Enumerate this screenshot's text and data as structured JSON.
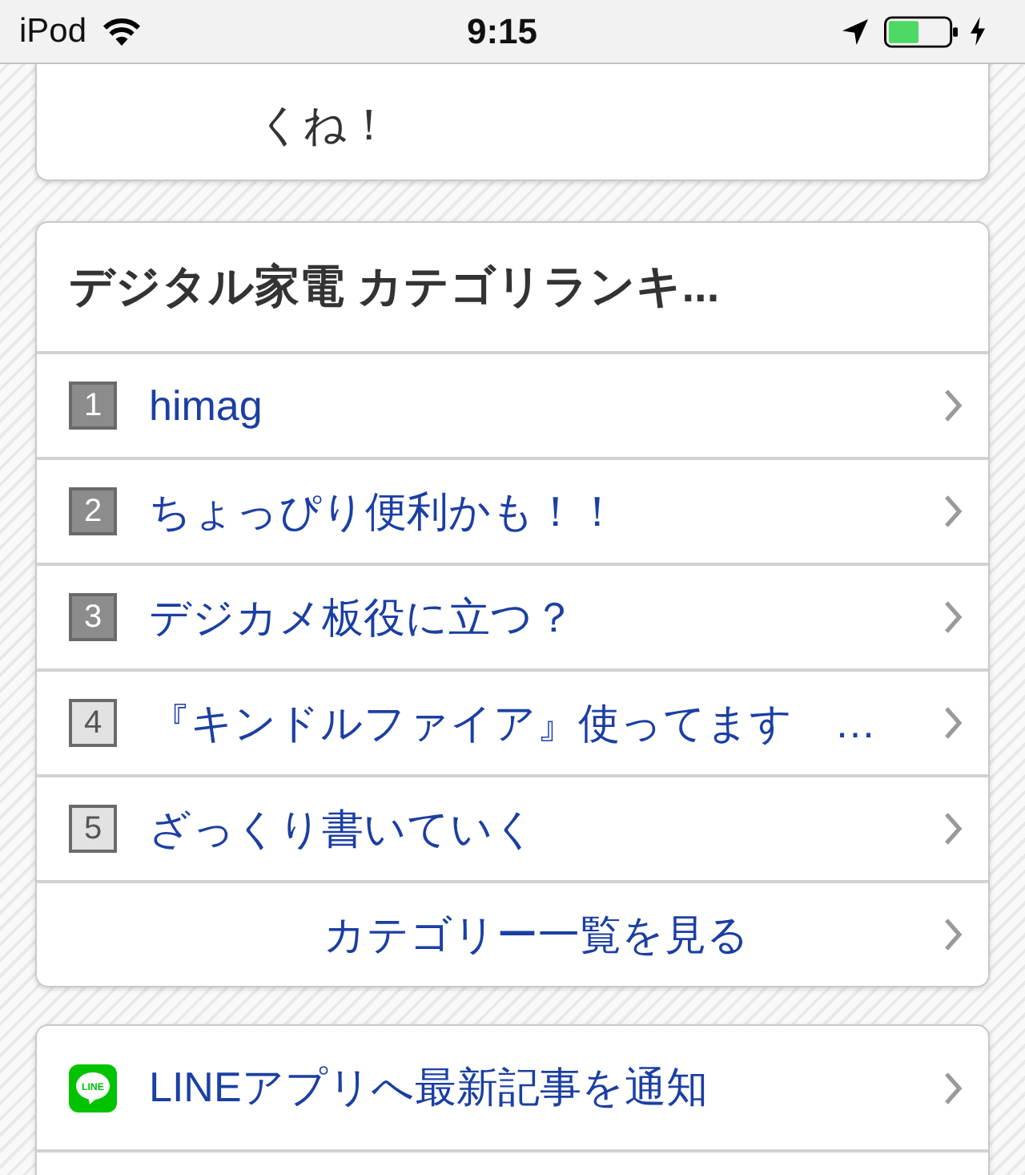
{
  "status_bar": {
    "carrier": "iPod",
    "time": "9:15"
  },
  "intro_card": {
    "text": "くね！"
  },
  "ranking_card": {
    "title": "デジタル家電 カテゴリランキ...",
    "items": [
      {
        "rank": "1",
        "title": "himag",
        "top_rank": true
      },
      {
        "rank": "2",
        "title": "ちょっぴり便利かも！！",
        "top_rank": true
      },
      {
        "rank": "3",
        "title": "デジカメ板役に立つ？",
        "top_rank": true
      },
      {
        "rank": "4",
        "title": "『キンドルファイア』使ってます　…",
        "top_rank": false
      },
      {
        "rank": "5",
        "title": "ざっくり書いていく",
        "top_rank": false
      }
    ],
    "more_link": "カテゴリー一覧を見る"
  },
  "line_card": {
    "icon_text": "LINE",
    "label": "LINEアプリへ最新記事を通知"
  }
}
